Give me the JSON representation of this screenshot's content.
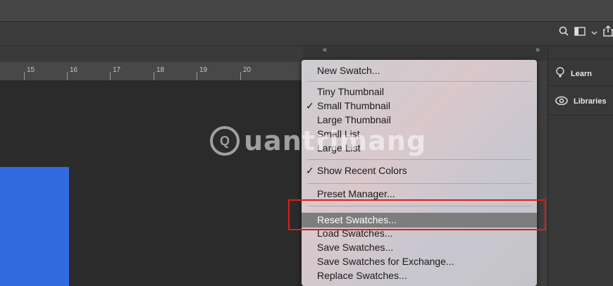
{
  "toolbar": {
    "icons": [
      "search-icon",
      "workspace-icon",
      "chevron-down-icon",
      "share-icon"
    ]
  },
  "panel_header": {
    "collapse_left": "«",
    "collapse_right": "»"
  },
  "ruler": {
    "ticks": [
      "15",
      "16",
      "17",
      "18",
      "19",
      "20"
    ]
  },
  "right_panel": {
    "items": [
      {
        "label": "Learn",
        "icon": "lightbulb-icon"
      },
      {
        "label": "Libraries",
        "icon": "creative-cloud-icon"
      }
    ]
  },
  "menu": {
    "new_swatch": "New Swatch...",
    "tiny_thumbnail": "Tiny Thumbnail",
    "small_thumbnail": "Small Thumbnail",
    "large_thumbnail": "Large Thumbnail",
    "small_list": "Small List",
    "large_list": "Large List",
    "show_recent_colors": "Show Recent Colors",
    "preset_manager": "Preset Manager...",
    "reset_swatches": "Reset Swatches...",
    "load_swatches": "Load Swatches...",
    "save_swatches": "Save Swatches...",
    "save_swatches_exchange": "Save Swatches for Exchange...",
    "replace_swatches": "Replace Swatches...",
    "checkmark": "✓"
  },
  "watermark": {
    "text": "uantrimang",
    "logo_letter": "Q"
  },
  "colors": {
    "accent_blue": "#2f6ae0",
    "highlight_red": "#e21b1b",
    "menu_highlight": "#7d7d7d"
  }
}
